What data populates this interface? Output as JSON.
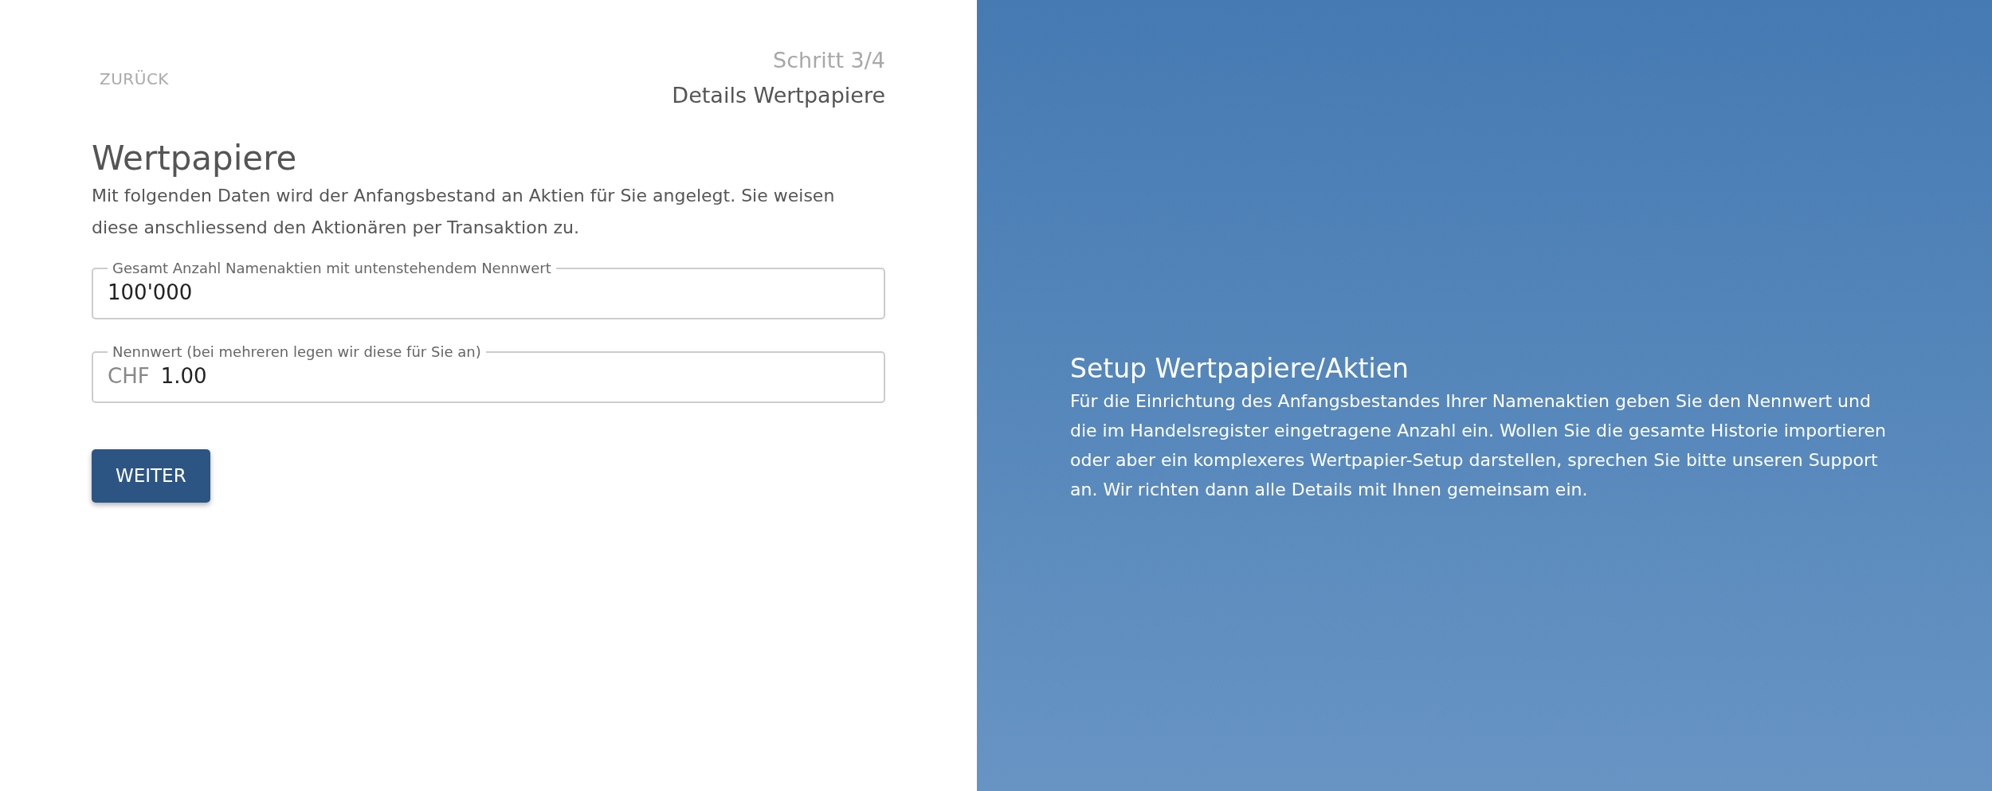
{
  "back_link": "ZURÜCK",
  "step": {
    "counter": "Schritt 3/4",
    "name": "Details Wertpapiere"
  },
  "form": {
    "title": "Wertpapiere",
    "description": "Mit folgenden Daten wird der Anfangsbestand an Aktien für Sie angelegt. Sie weisen diese anschliessend den Aktionären per Transaktion zu.",
    "fields": [
      {
        "label": "Gesamt Anzahl Namenaktien mit untenstehendem Nennwert",
        "value": "100'000"
      },
      {
        "label": "Nennwert (bei mehreren legen wir diese für Sie an)",
        "prefix": "CHF",
        "value": "1.00"
      }
    ],
    "submit": "WEITER"
  },
  "info_panel": {
    "title": "Setup Wertpapiere/Aktien",
    "text": "Für die Einrichtung des Anfangsbestandes Ihrer Namenaktien geben Sie den Nennwert und die im Handelsregister eingetragene Anzahl ein. Wollen Sie die gesamte Historie importieren oder aber ein komplexeres Wertpapier-Setup darstellen, sprechen Sie bitte unseren Support an. Wir richten dann alle Details mit Ihnen gemeinsam ein."
  }
}
